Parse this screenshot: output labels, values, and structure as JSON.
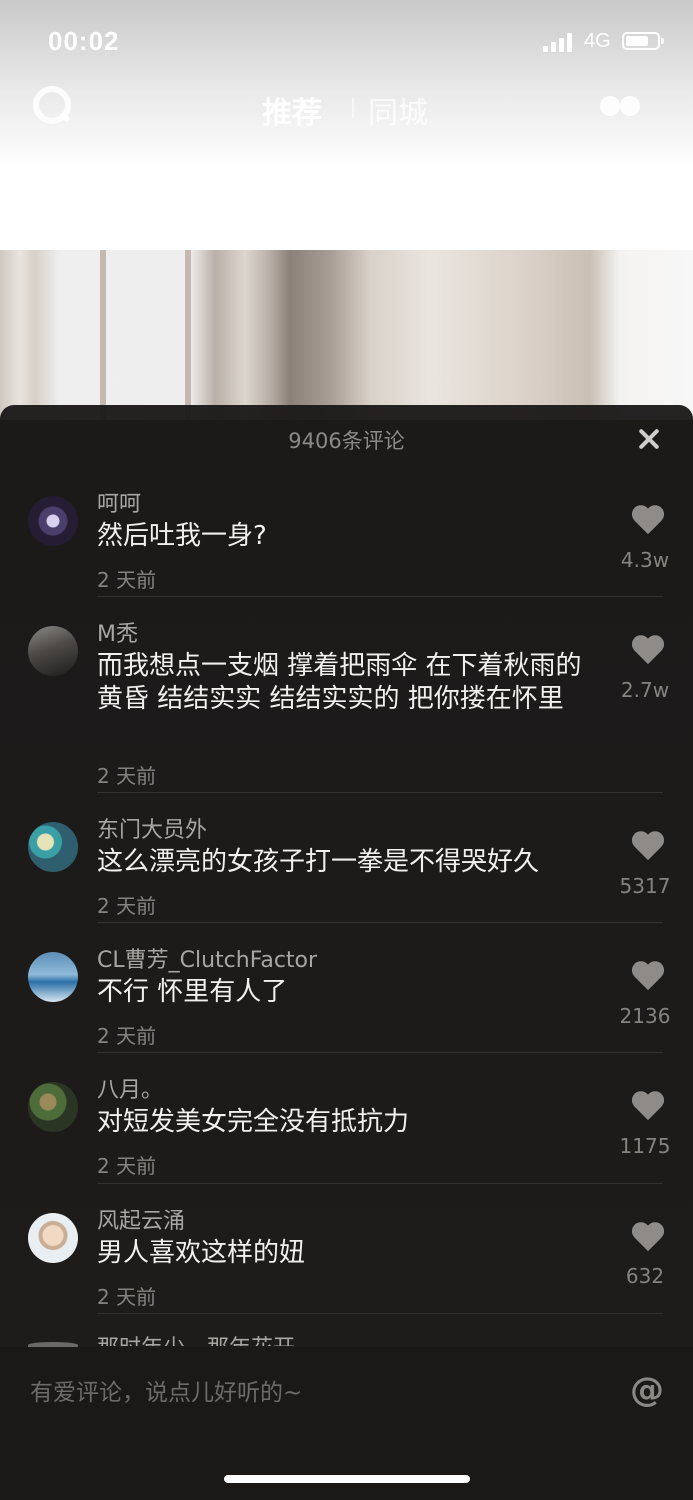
{
  "status_bar": {
    "time": "00:02",
    "network": "4G"
  },
  "top_nav": {
    "tab_recommend": "推荐",
    "tab_local": "同城"
  },
  "comment_panel": {
    "title": "9406条评论",
    "comments": [
      {
        "username": "呵呵",
        "text": "然后吐我一身?",
        "time": "2 天前",
        "likes": "4.3w"
      },
      {
        "username": "M秃",
        "text": "而我想点一支烟 撑着把雨伞 在下着秋雨的黄昏 结结实实 结结实实的 把你搂在怀里",
        "time": "2 天前",
        "likes": "2.7w"
      },
      {
        "username": "东门大员外",
        "text": "这么漂亮的女孩子打一拳是不得哭好久",
        "time": "2 天前",
        "likes": "5317"
      },
      {
        "username": "CL曹芳_ClutchFactor",
        "text": "不行 怀里有人了",
        "time": "2 天前",
        "likes": "2136"
      },
      {
        "username": "八月。",
        "text": "对短发美女完全没有抵抗力",
        "time": "2 天前",
        "likes": "1175"
      },
      {
        "username": "风起云涌",
        "text": "男人喜欢这样的妞",
        "time": "2 天前",
        "likes": "632"
      }
    ],
    "partial_username": "那时年少，那年花开"
  },
  "input": {
    "placeholder": "有爱评论，说点儿好听的~",
    "at_symbol": "@"
  },
  "icons": {
    "search": "search-icon",
    "more": "dots-icon",
    "close": "close-icon",
    "like": "heart-icon",
    "mention": "at-icon"
  }
}
